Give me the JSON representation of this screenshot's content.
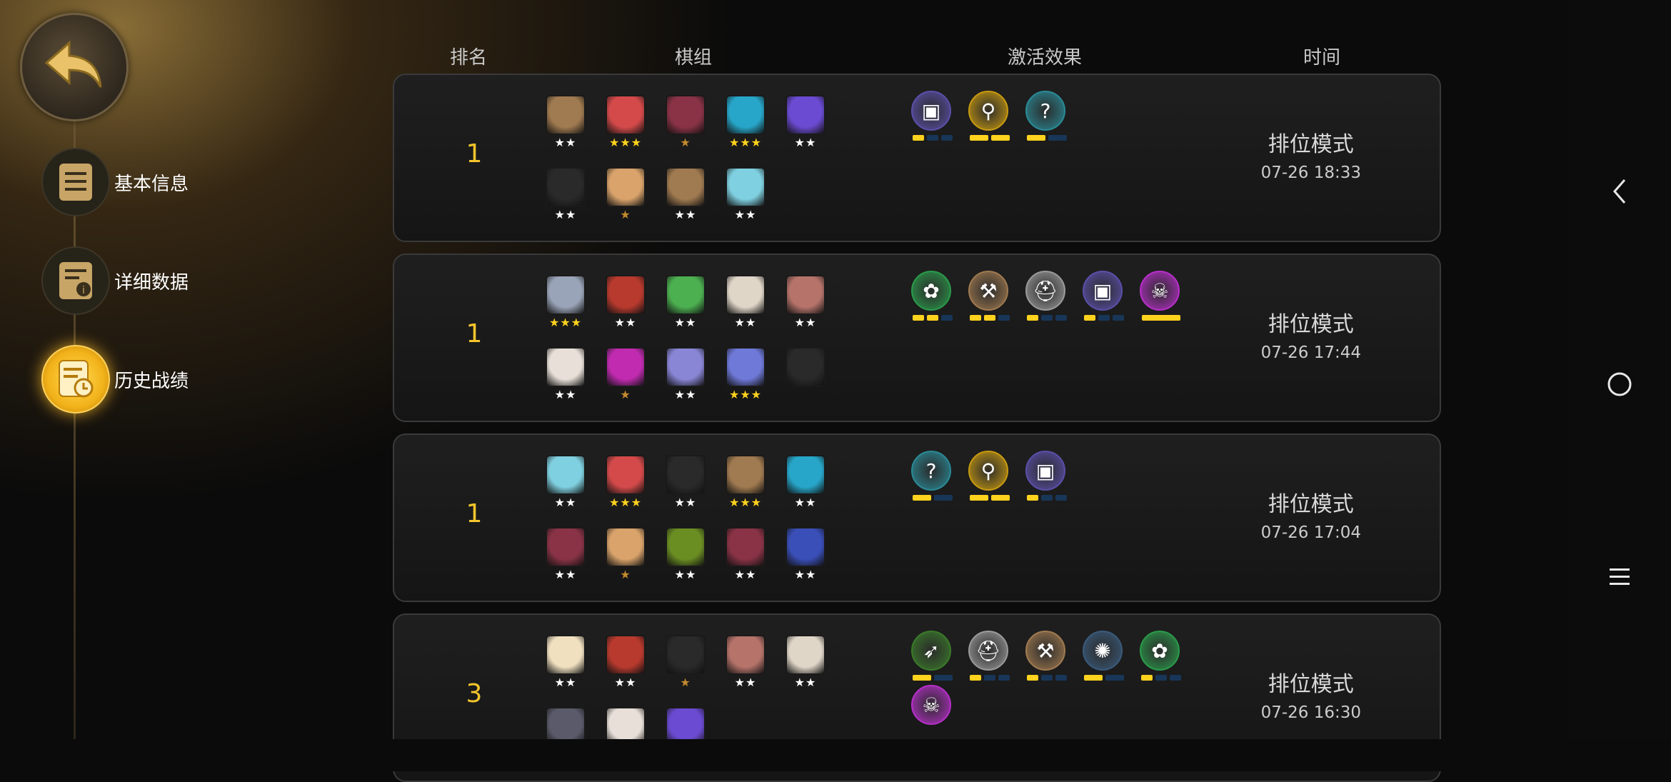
{
  "headers": {
    "rank": "排名",
    "lineup": "棋组",
    "traits": "激活效果",
    "time": "时间"
  },
  "sidebar": {
    "items": [
      {
        "label": "基本信息"
      },
      {
        "label": "详细数据"
      },
      {
        "label": "历史战绩"
      }
    ]
  },
  "matches": [
    {
      "rank": "1",
      "mode": "排位模式",
      "time": "07-26 18:33",
      "units": [
        {
          "color": "#a07a50",
          "stars": "★★",
          "star_color": "#ffffff"
        },
        {
          "color": "#d44a4a",
          "stars": "★★★",
          "star_color": "#ffd21e"
        },
        {
          "color": "#8a3346",
          "stars": "★",
          "star_color": "#c38a2e"
        },
        {
          "color": "#27a6c9",
          "stars": "★★★",
          "star_color": "#ffd21e"
        },
        {
          "color": "#6a4bd1",
          "stars": "★★",
          "star_color": "#ffffff"
        },
        {
          "color": "#2a2a2a",
          "stars": "★★",
          "star_color": "#ffffff"
        },
        {
          "color": "#d9a36b",
          "stars": "★",
          "star_color": "#c38a2e"
        },
        {
          "color": "#a07a50",
          "stars": "★★",
          "star_color": "#ffffff"
        },
        {
          "color": "#7fd0e0",
          "stars": "★★",
          "star_color": "#ffffff"
        }
      ],
      "traits": [
        {
          "icon": "shield-rune",
          "color": "#5a4fa8",
          "glyph": "▣",
          "pips": [
            1,
            0,
            0
          ]
        },
        {
          "icon": "gold-emblem",
          "color": "#c89a10",
          "glyph": "⚲",
          "pips": [
            1,
            1
          ]
        },
        {
          "icon": "mystic-question",
          "color": "#2a8a96",
          "glyph": "?",
          "pips": [
            1,
            0
          ]
        }
      ]
    },
    {
      "rank": "1",
      "mode": "排位模式",
      "time": "07-26 17:44",
      "units": [
        {
          "color": "#9aa4b8",
          "stars": "★★★",
          "star_color": "#ffd21e"
        },
        {
          "color": "#b83a2e",
          "stars": "★★",
          "star_color": "#ffffff"
        },
        {
          "color": "#4caf50",
          "stars": "★★",
          "star_color": "#ffffff"
        },
        {
          "color": "#e0d6c8",
          "stars": "★★",
          "star_color": "#ffffff"
        },
        {
          "color": "#b5736a",
          "stars": "★★",
          "star_color": "#ffffff"
        },
        {
          "color": "#e8e0d8",
          "stars": "★★",
          "star_color": "#ffffff"
        },
        {
          "color": "#c02bb0",
          "stars": "★",
          "star_color": "#c38a2e"
        },
        {
          "color": "#8a86d6",
          "stars": "★★",
          "star_color": "#ffffff"
        },
        {
          "color": "#6f79d8",
          "stars": "★★★",
          "star_color": "#ffd21e"
        },
        {
          "color": "#2a2a2a",
          "stars": "",
          "star_color": "#ffffff"
        }
      ],
      "traits": [
        {
          "icon": "paw",
          "color": "#2a9a4a",
          "glyph": "✿",
          "pips": [
            1,
            1,
            0
          ]
        },
        {
          "icon": "axe",
          "color": "#a07a50",
          "glyph": "⚒",
          "pips": [
            1,
            1,
            0
          ]
        },
        {
          "icon": "helmet",
          "color": "#9a9a9a",
          "glyph": "⛑",
          "pips": [
            1,
            0,
            0
          ]
        },
        {
          "icon": "shield-rune",
          "color": "#5a4fa8",
          "glyph": "▣",
          "pips": [
            1,
            0,
            0
          ]
        },
        {
          "icon": "demon-skull",
          "color": "#b62fc8",
          "glyph": "☠",
          "pips": [
            1
          ]
        }
      ]
    },
    {
      "rank": "1",
      "mode": "排位模式",
      "time": "07-26 17:04",
      "units": [
        {
          "color": "#7fd0e0",
          "stars": "★★",
          "star_color": "#ffffff"
        },
        {
          "color": "#d44a4a",
          "stars": "★★★",
          "star_color": "#ffd21e"
        },
        {
          "color": "#2a2a2a",
          "stars": "★★",
          "star_color": "#ffffff"
        },
        {
          "color": "#a07a50",
          "stars": "★★★",
          "star_color": "#ffd21e"
        },
        {
          "color": "#27a6c9",
          "stars": "★★",
          "star_color": "#ffffff"
        },
        {
          "color": "#8a3346",
          "stars": "★★",
          "star_color": "#ffffff"
        },
        {
          "color": "#d9a36b",
          "stars": "★",
          "star_color": "#c38a2e"
        },
        {
          "color": "#6b8e23",
          "stars": "★★",
          "star_color": "#ffffff"
        },
        {
          "color": "#8a3346",
          "stars": "★★",
          "star_color": "#ffffff"
        },
        {
          "color": "#3a4fb8",
          "stars": "★★",
          "star_color": "#ffffff"
        }
      ],
      "traits": [
        {
          "icon": "mystic-question",
          "color": "#2a8a96",
          "glyph": "?",
          "pips": [
            1,
            0
          ]
        },
        {
          "icon": "gold-emblem",
          "color": "#c89a10",
          "glyph": "⚲",
          "pips": [
            1,
            1
          ]
        },
        {
          "icon": "shield-rune",
          "color": "#5a4fa8",
          "glyph": "▣",
          "pips": [
            1,
            0,
            0
          ]
        }
      ]
    },
    {
      "rank": "3",
      "mode": "排位模式",
      "time": "07-26 16:30",
      "units": [
        {
          "color": "#f0e0c0",
          "stars": "★★",
          "star_color": "#ffffff"
        },
        {
          "color": "#b83a2e",
          "stars": "★★",
          "star_color": "#ffffff"
        },
        {
          "color": "#2a2a2a",
          "stars": "★",
          "star_color": "#c38a2e"
        },
        {
          "color": "#b5736a",
          "stars": "★★",
          "star_color": "#ffffff"
        },
        {
          "color": "#e0d6c8",
          "stars": "★★",
          "star_color": "#ffffff"
        },
        {
          "color": "#5a5a6a",
          "stars": "",
          "star_color": "#ffffff"
        },
        {
          "color": "#e8e0d8",
          "stars": "",
          "star_color": "#ffffff"
        },
        {
          "color": "#6a4bd1",
          "stars": "",
          "star_color": "#ffffff"
        }
      ],
      "traits": [
        {
          "icon": "bow",
          "color": "#3a7a2a",
          "glyph": "➶",
          "pips": [
            1,
            0
          ]
        },
        {
          "icon": "helmet",
          "color": "#9a9a9a",
          "glyph": "⛑",
          "pips": [
            1,
            0,
            0
          ]
        },
        {
          "icon": "axe",
          "color": "#a07a50",
          "glyph": "⚒",
          "pips": [
            1,
            0,
            0
          ]
        },
        {
          "icon": "gear-sigil",
          "color": "#3a5a7a",
          "glyph": "✺",
          "pips": [
            1,
            0
          ]
        },
        {
          "icon": "paw",
          "color": "#2a9a4a",
          "glyph": "✿",
          "pips": [
            1,
            0,
            0
          ]
        },
        {
          "icon": "demon-skull",
          "color": "#b62fc8",
          "glyph": "☠",
          "pips": []
        }
      ]
    }
  ]
}
